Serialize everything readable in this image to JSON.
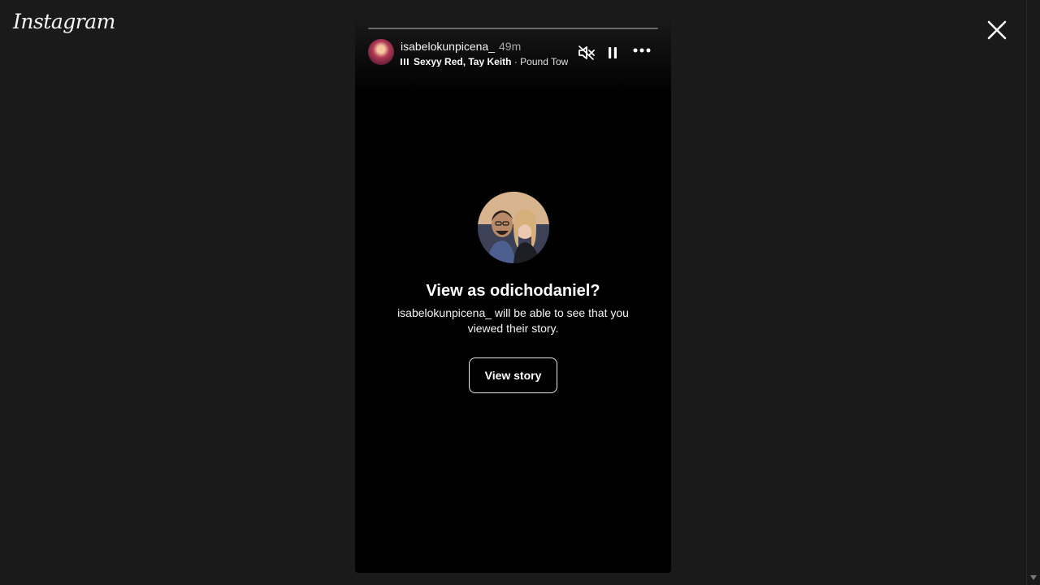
{
  "app": {
    "logo_text": "Instagram"
  },
  "story": {
    "progress_fraction": 0,
    "username": "isabelokunpicena_",
    "time_ago": "49m",
    "music": {
      "artists": "Sexyy Red, Tay Keith",
      "separator": " · ",
      "song": "Pound Town"
    }
  },
  "prompt": {
    "title": "View as odichodaniel?",
    "description": "isabelokunpicena_ will be able to see that you viewed their story.",
    "button_label": "View story"
  },
  "icons": {
    "close": "close-icon",
    "mute": "speaker-muted-icon",
    "pause": "pause-icon",
    "more": "more-options-icon",
    "music": "audio-bars-icon"
  }
}
